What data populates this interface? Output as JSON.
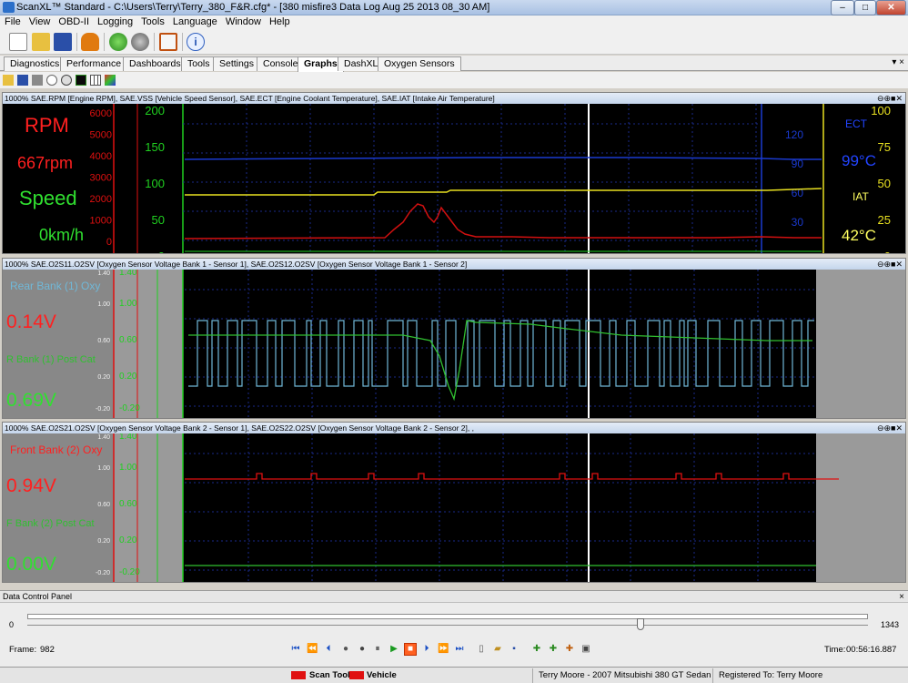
{
  "window": {
    "title": "ScanXL™ Standard - C:\\Users\\Terry\\Terry_380_F&R.cfg* - [380 misfire3 Data Log Aug 25 2013 08_30 AM]",
    "controls": {
      "minimize": "–",
      "maximize": "□",
      "close": "✕"
    }
  },
  "menu": [
    "File",
    "View",
    "OBD-II",
    "Logging",
    "Tools",
    "Language",
    "Window",
    "Help"
  ],
  "toolbar": {
    "icons": [
      "new-document-icon",
      "open-folder-icon",
      "save-disk-icon",
      "vehicle-icon",
      "connect-icon",
      "disconnect-icon",
      "fullscreen-icon",
      "info-icon"
    ]
  },
  "tabs": [
    {
      "label": "Diagnostics",
      "active": false
    },
    {
      "label": "Performance",
      "active": false
    },
    {
      "label": "Dashboards",
      "active": false
    },
    {
      "label": "Tools",
      "active": false
    },
    {
      "label": "Settings",
      "active": false
    },
    {
      "label": "Console",
      "active": false
    },
    {
      "label": "Graphs",
      "active": true
    },
    {
      "label": "DashXL",
      "active": false
    },
    {
      "label": "Oxygen Sensors",
      "active": false
    }
  ],
  "tab_pin": "▾ ×",
  "panel_controls": "⊖⊕■✕",
  "graph_panels": [
    {
      "header": "1000% SAE.RPM [Engine RPM], SAE.VSS [Vehicle Speed Sensor], SAE.ECT [Engine Coolant Temperature], SAE.IAT [Intake Air Temperature]",
      "left_labels": [
        {
          "text": "RPM",
          "color": "#ff2020"
        },
        {
          "text": "667rpm",
          "color": "#ff2020"
        },
        {
          "text": "Speed",
          "color": "#30e030"
        },
        {
          "text": "0km/h",
          "color": "#30e030"
        }
      ],
      "right_labels": [
        {
          "text": "ECT",
          "color": "#2244ff"
        },
        {
          "text": "99°C",
          "color": "#2244ff"
        },
        {
          "text": "IAT",
          "color": "#ffff60"
        },
        {
          "text": "42°C",
          "color": "#ffff60"
        }
      ],
      "rpm_ticks": [
        "6000",
        "5000",
        "4000",
        "3000",
        "2000",
        "1000",
        "0"
      ],
      "speed_ticks": [
        "200",
        "150",
        "100",
        "50",
        "0"
      ],
      "ect_ticks": [
        "120",
        "90",
        "60",
        "30"
      ],
      "iat_ticks": [
        "100",
        "75",
        "50",
        "25",
        "0"
      ]
    },
    {
      "header": "1000% SAE.O2S11.O2SV [Oxygen Sensor Voltage Bank 1 - Sensor 1], SAE.O2S12.O2SV [Oxygen Sensor Voltage Bank 1 - Sensor 2]",
      "left_labels": [
        {
          "text": "Rear Bank (1) Oxy",
          "color": "#70b8d8"
        },
        {
          "text": "0.14V",
          "color": "#ff2020"
        },
        {
          "text": "R Bank (1) Post Cat",
          "color": "#30c030"
        },
        {
          "text": "0.69V",
          "color": "#30e030"
        }
      ],
      "axis1_ticks": [
        "1.40",
        "1.00",
        "0.60",
        "0.20",
        "-0.20"
      ],
      "axis2_ticks": [
        "1.40",
        "1.00",
        "0.60",
        "0.20",
        "-0.20"
      ]
    },
    {
      "header": "1000% SAE.O2S21.O2SV [Oxygen Sensor Voltage Bank 2 - Sensor 1], SAE.O2S22.O2SV [Oxygen Sensor Voltage Bank 2 - Sensor 2], ,",
      "left_labels": [
        {
          "text": "Front Bank (2) Oxy",
          "color": "#ff2020"
        },
        {
          "text": "0.94V",
          "color": "#ff2020"
        },
        {
          "text": "F Bank (2) Post Cat",
          "color": "#30c030"
        },
        {
          "text": "0.00V",
          "color": "#30e030"
        }
      ],
      "axis1_ticks": [
        "1.40",
        "1.00",
        "0.60",
        "0.20",
        "-0.20"
      ],
      "axis2_ticks": [
        "1.40",
        "1.00",
        "0.60",
        "0.20",
        "-0.20"
      ]
    }
  ],
  "data_control_panel": {
    "title": "Data Control Panel",
    "close": "×",
    "slider_min": "0",
    "slider_max": "1343",
    "slider_value": 982,
    "frame_label": "Frame:",
    "frame_value": "982",
    "time_label": "Time:",
    "time_value": "00:56:16.887",
    "playback_icons": [
      "skip-first-icon",
      "fast-rewind-icon",
      "step-back-icon",
      "record-small-icon",
      "record-icon",
      "pause-icon",
      "play-icon",
      "stop-icon",
      "step-forward-icon",
      "fast-forward-icon",
      "skip-last-icon"
    ]
  },
  "status_bar": {
    "scan_tool": "Scan Tool",
    "vehicle": "Vehicle",
    "vehicle_info": "Terry Moore - 2007 Mitsubishi 380 GT Sedan",
    "registered": "Registered To: Terry Moore"
  },
  "colors": {
    "rpm": "#d01010",
    "speed": "#20d020",
    "ect": "#1a3ad0",
    "iat": "#e8e020",
    "o2_blue": "#70b8d8",
    "o2_green": "#30c030"
  }
}
